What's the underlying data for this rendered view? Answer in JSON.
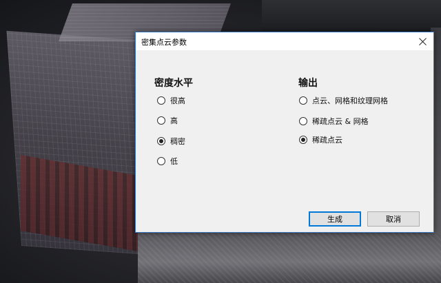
{
  "dialog": {
    "title": "密集点云参数",
    "density": {
      "heading": "密度水平",
      "options": [
        {
          "label": "很高",
          "checked": false
        },
        {
          "label": "高",
          "checked": false
        },
        {
          "label": "稠密",
          "checked": true
        },
        {
          "label": "低",
          "checked": false
        }
      ]
    },
    "output": {
      "heading": "输出",
      "options": [
        {
          "label": "点云、网格和纹理网格",
          "checked": false
        },
        {
          "label": "稀疏点云 & 网格",
          "checked": false
        },
        {
          "label": "稀疏点云",
          "checked": true
        }
      ]
    },
    "buttons": {
      "generate": "生成",
      "cancel": "取消"
    }
  },
  "colors": {
    "dialog_border": "#3b78c4",
    "primary_button_border": "#0078d7"
  }
}
